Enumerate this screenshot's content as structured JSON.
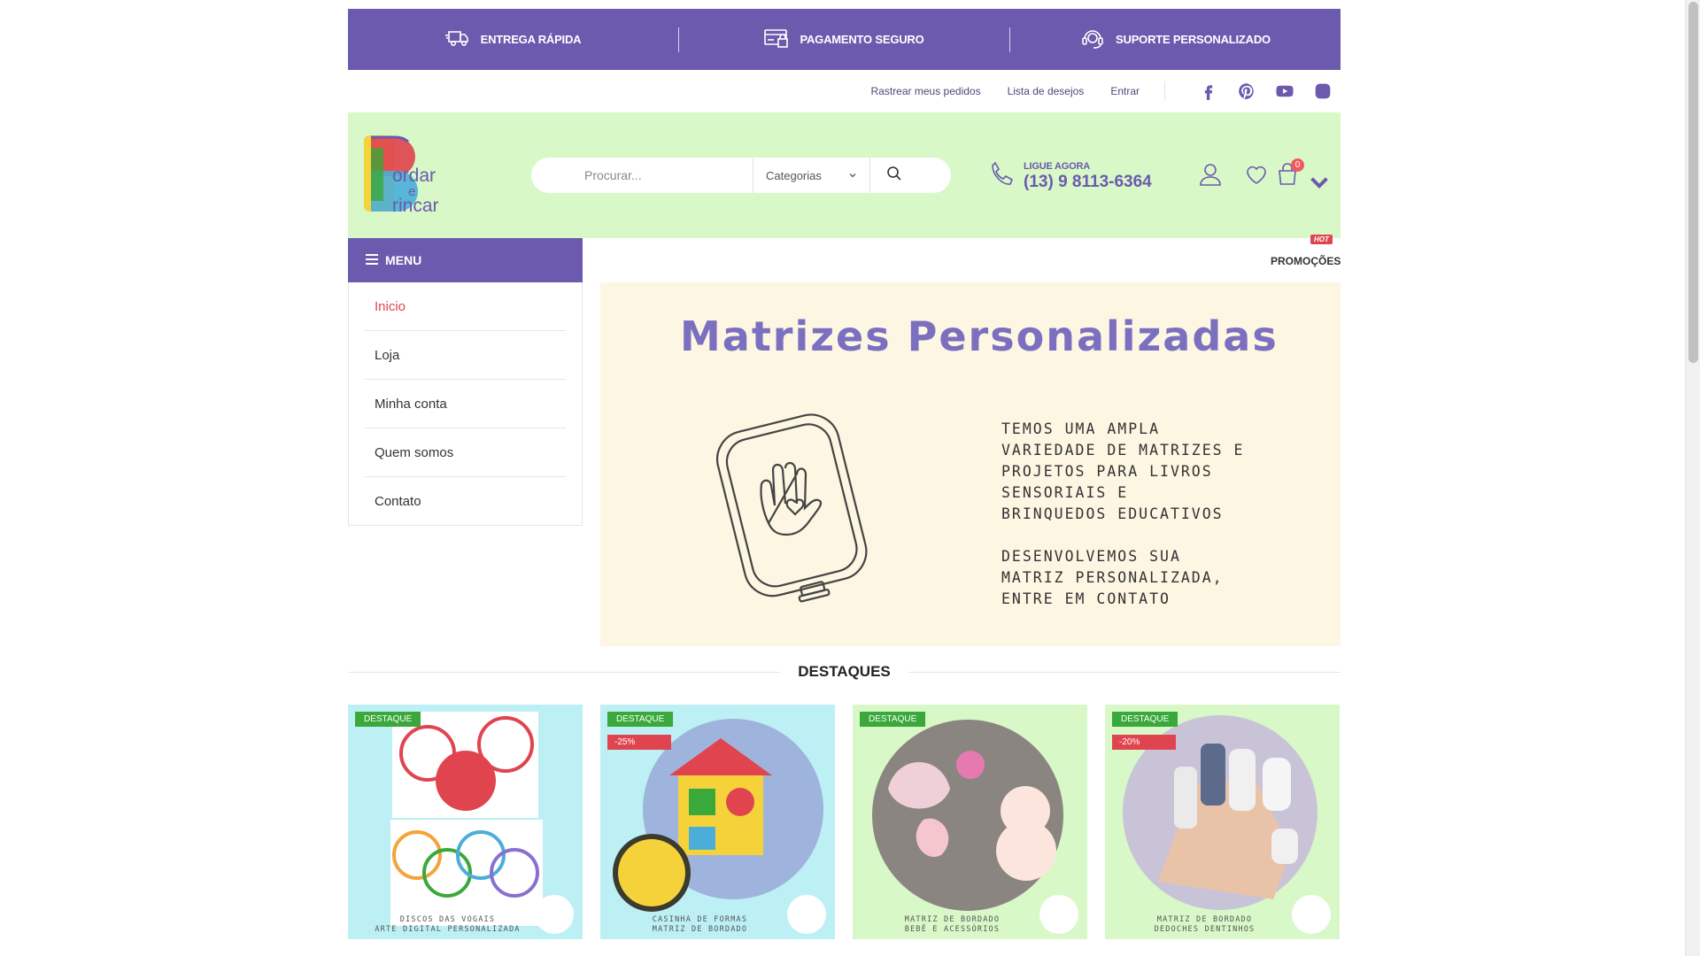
{
  "infobar": {
    "items": [
      {
        "label": "ENTREGA RÁPIDA",
        "icon": "truck-icon"
      },
      {
        "label": "PAGAMENTO SEGURO",
        "icon": "credit-card-icon"
      },
      {
        "label": "SUPORTE PERSONALIZADO",
        "icon": "headset-icon"
      }
    ]
  },
  "toplinks": {
    "track": "Rastrear meus pedidos",
    "wishlist": "Lista de desejos",
    "login": "Entrar",
    "social": [
      "facebook-icon",
      "pinterest-icon",
      "youtube-icon",
      "instagram-icon"
    ]
  },
  "header": {
    "search_placeholder": "Procurar...",
    "category_label": "Categorias",
    "phone_label": "LIGUE AGORA",
    "phone_number": "(13) 9 8113-6364",
    "cart_count": "0"
  },
  "colors": {
    "brand_purple": "#6b5aad",
    "header_green": "#d8f8c8",
    "accent_red": "#e0454f",
    "badge_green": "#3aa83a"
  },
  "menu": {
    "title": "MENU",
    "items": [
      {
        "label": "Inicio",
        "active": true
      },
      {
        "label": "Loja",
        "active": false
      },
      {
        "label": "Minha conta",
        "active": false
      },
      {
        "label": "Quem somos",
        "active": false
      },
      {
        "label": "Contato",
        "active": false
      }
    ]
  },
  "promo": {
    "label": "PROMOÇÕES",
    "hot": "HOT"
  },
  "banner": {
    "title": "Matrizes Personalizadas",
    "text": "TEMOS UMA AMPLA\nVARIEDADE DE MATRIZES E\nPROJETOS PARA LIVROS\nSENSORIAIS E\nBRINQUEDOS EDUCATIVOS\n\nDESENVOLVEMOS SUA\nMATRIZ PERSONALIZADA,\nENTRE EM CONTATO"
  },
  "section": {
    "title": "DESTAQUES"
  },
  "products": [
    {
      "badge": "DESTAQUE",
      "discount": "",
      "caption_1": "DISCOS DAS VOGAIS",
      "caption_2": "ARTE DIGITAL PERSONALIZADA"
    },
    {
      "badge": "DESTAQUE",
      "discount": "-25%",
      "caption_1": "CASINHA DE FORMAS",
      "caption_2": "MATRIZ DE BORDADO"
    },
    {
      "badge": "DESTAQUE",
      "discount": "",
      "caption_1": "MATRIZ DE BORDADO",
      "caption_2": "BEBÊ E ACESSÓRIOS"
    },
    {
      "badge": "DESTAQUE",
      "discount": "-20%",
      "caption_1": "MATRIZ DE BORDADO",
      "caption_2": "DEDOCHES DENTINHOS"
    }
  ],
  "logo": {
    "text_1": "ordar",
    "text_2": "e",
    "text_3": "rincar"
  }
}
